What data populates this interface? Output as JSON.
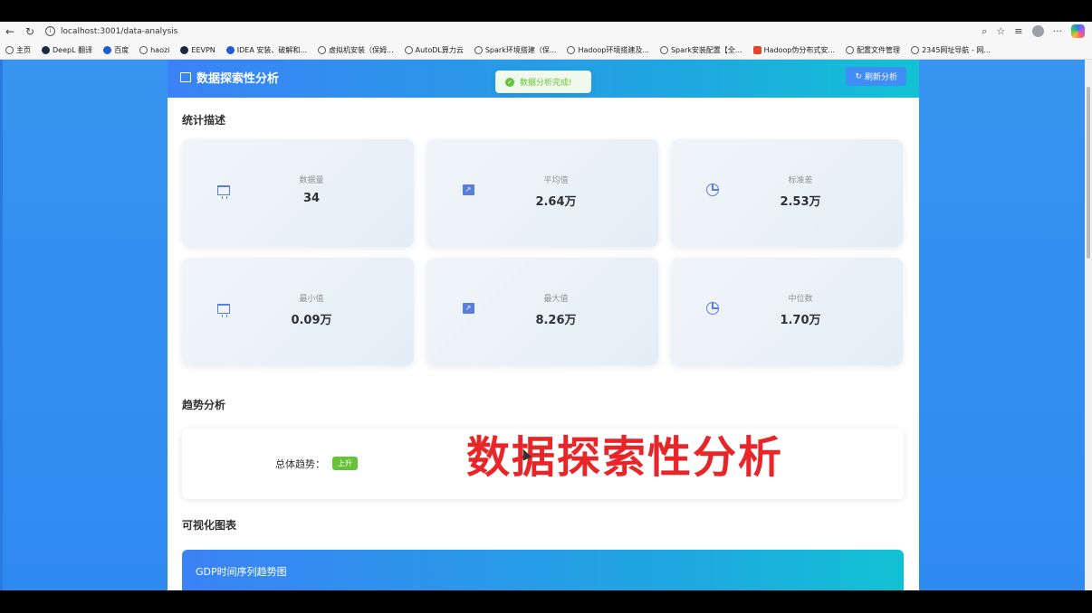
{
  "browser": {
    "url": "localhost:3001/data-analysis",
    "bookmarks": [
      {
        "label": "主页"
      },
      {
        "label": "DeepL 翻译"
      },
      {
        "label": "百度"
      },
      {
        "label": "haozi"
      },
      {
        "label": "EEVPN"
      },
      {
        "label": "IDEA 安装、破解和..."
      },
      {
        "label": "虚拟机安装（保姆..."
      },
      {
        "label": "AutoDL算力云"
      },
      {
        "label": "Spark环境搭建（保..."
      },
      {
        "label": "Hadoop环境搭建及..."
      },
      {
        "label": "Spark安装配置【全..."
      },
      {
        "label": "Hadoop伪分布式安..."
      },
      {
        "label": "配置文件管理"
      },
      {
        "label": "2345网址导航 - 网..."
      }
    ]
  },
  "header": {
    "title": "数据探索性分析",
    "refresh_label": "刷新分析"
  },
  "toast": {
    "message": "数据分析完成!"
  },
  "stats": {
    "section_title": "统计描述",
    "cards": [
      {
        "label": "数据量",
        "value": "34",
        "icon": "board-icon"
      },
      {
        "label": "平均值",
        "value": "2.64万",
        "icon": "trend-icon"
      },
      {
        "label": "标准差",
        "value": "2.53万",
        "icon": "pie-icon"
      },
      {
        "label": "最小值",
        "value": "0.09万",
        "icon": "board-icon"
      },
      {
        "label": "最大值",
        "value": "8.26万",
        "icon": "trend-icon"
      },
      {
        "label": "中位数",
        "value": "1.70万",
        "icon": "pie-icon"
      }
    ]
  },
  "trend": {
    "section_title": "趋势分析",
    "label": "总体趋势：",
    "tag": "上升"
  },
  "overlay": {
    "text": "数据探索性分析"
  },
  "charts": {
    "section_title": "可视化图表",
    "first_chart_title": "GDP时间序列趋势图"
  },
  "colors": {
    "accent": "#3b82f6",
    "success": "#67c23a",
    "overlay_red": "#e8262a"
  }
}
